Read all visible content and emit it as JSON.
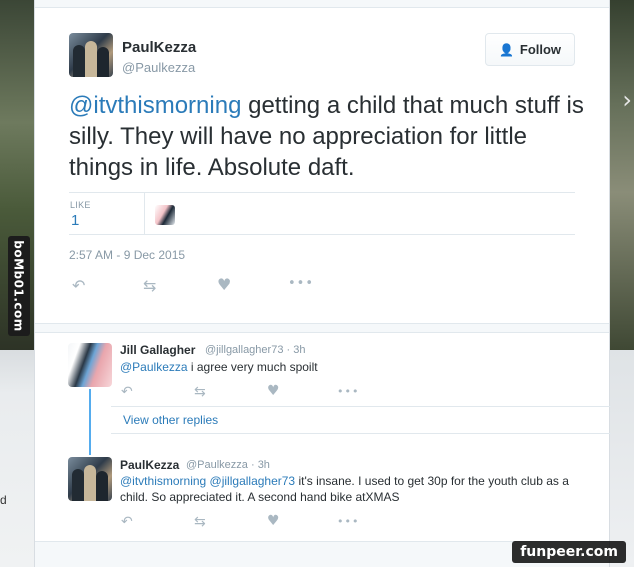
{
  "main_tweet": {
    "author_name": "PaulKezza",
    "author_handle": "@Paulkezza",
    "follow_label": "Follow",
    "text_mention": "@itvthismorning",
    "text_body": " getting a child that much stuff is silly. They will have no appreciation for little things in life.  Absolute daft.",
    "likes_label": "LIKE",
    "likes_count": "1",
    "timestamp": "2:57 AM - 9 Dec 2015"
  },
  "replies": [
    {
      "name": "Jill Gallagher",
      "handle": "@jillgallagher73 · 3h",
      "mention": "@Paulkezza",
      "text": " i agree very much spoilt"
    },
    {
      "name": "PaulKezza",
      "handle": "@Paulkezza · 3h",
      "mention": "@itvthismorning @jillgallagher73",
      "text": " it's insane.  I used to get 30p for the youth club as a child. So appreciated it. A second hand bike atXMAS"
    }
  ],
  "view_other_replies": "View other replies",
  "watermarks": {
    "left": "boMb01.com",
    "right": "funpeer.com"
  },
  "side_text": "d",
  "icons": {
    "reply": "reply-icon",
    "retweet": "retweet-icon",
    "like": "heart-icon",
    "more": "more-icon",
    "follow": "follow-person-icon",
    "next": "chevron-right-icon"
  },
  "colors": {
    "link": "#2b7bb9",
    "thread": "#55acee",
    "muted": "#8899a6"
  }
}
